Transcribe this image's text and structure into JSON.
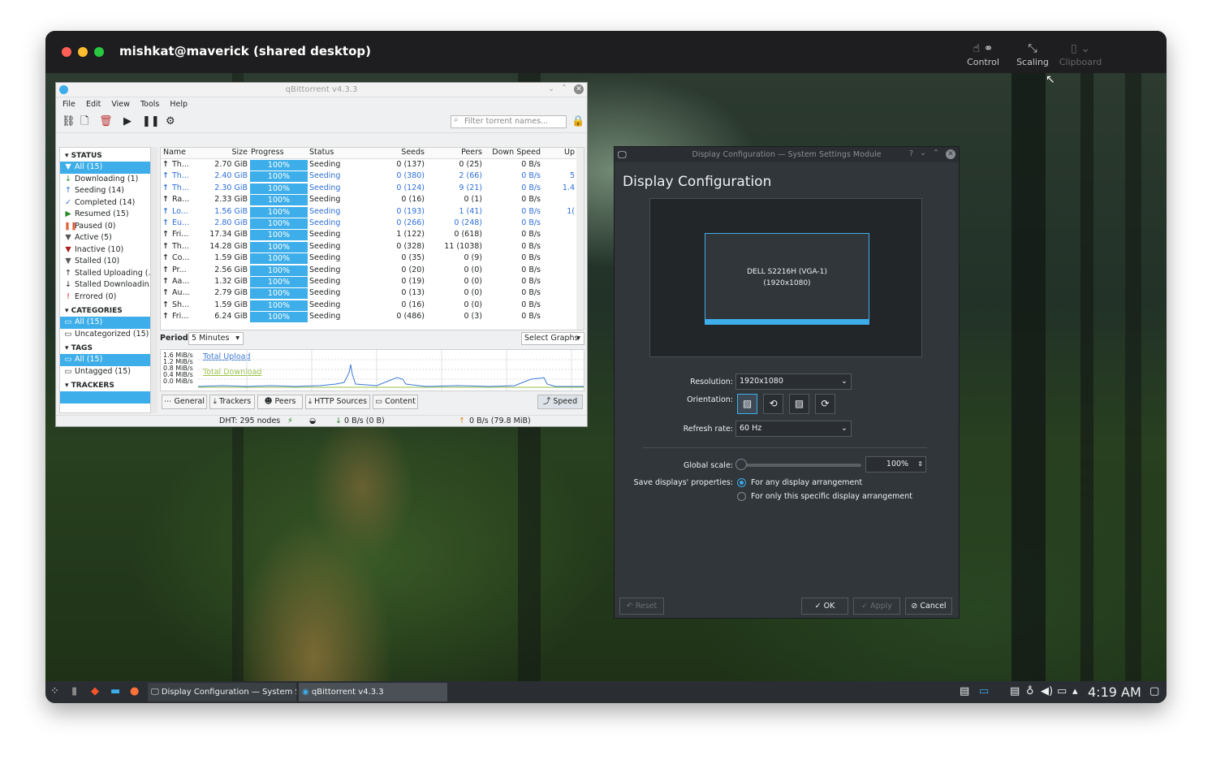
{
  "mac_window": {
    "title": "mishkat@maverick (shared desktop)",
    "controls": [
      {
        "label": "Control",
        "icon": "control-icon"
      },
      {
        "label": "Scaling",
        "icon": "scaling-icon"
      },
      {
        "label": "Clipboard",
        "icon": "clipboard-icon"
      }
    ]
  },
  "qbittorrent": {
    "title": "qBittorrent v4.3.3",
    "menu": [
      "File",
      "Edit",
      "View",
      "Tools",
      "Help"
    ],
    "filter_placeholder": "Filter torrent names...",
    "sidebar": {
      "status_header": "STATUS",
      "status": [
        "All (15)",
        "Downloading (1)",
        "Seeding (14)",
        "Completed (14)",
        "Resumed (15)",
        "Paused (0)",
        "Active (5)",
        "Inactive (10)",
        "Stalled (10)",
        "Stalled Uploading (...",
        "Stalled Downloadin...",
        "Errored (0)"
      ],
      "categories_header": "CATEGORIES",
      "categories": [
        "All (15)",
        "Uncategorized (15)"
      ],
      "tags_header": "TAGS",
      "tags": [
        "All (15)",
        "Untagged (15)"
      ],
      "trackers_header": "TRACKERS"
    },
    "columns": [
      "Name",
      "Size",
      "Progress",
      "Status",
      "Seeds",
      "Peers",
      "Down Speed",
      "Up"
    ],
    "rows": [
      {
        "name": "Th...",
        "size": "2.70 GiB",
        "progress": "100%",
        "status": "Seeding",
        "seeds": "0 (137)",
        "peers": "0 (25)",
        "down": "0 B/s",
        "up": "",
        "blue": false
      },
      {
        "name": "Th...",
        "size": "2.40 GiB",
        "progress": "100%",
        "status": "Seeding",
        "seeds": "0 (380)",
        "peers": "2 (66)",
        "down": "0 B/s",
        "up": "5",
        "blue": true
      },
      {
        "name": "Th...",
        "size": "2.30 GiB",
        "progress": "100%",
        "status": "Seeding",
        "seeds": "0 (124)",
        "peers": "9 (21)",
        "down": "0 B/s",
        "up": "1.4",
        "blue": true
      },
      {
        "name": "Ra...",
        "size": "2.33 GiB",
        "progress": "100%",
        "status": "Seeding",
        "seeds": "0 (16)",
        "peers": "0 (1)",
        "down": "0 B/s",
        "up": "",
        "blue": false
      },
      {
        "name": "Lo...",
        "size": "1.56 GiB",
        "progress": "100%",
        "status": "Seeding",
        "seeds": "0 (193)",
        "peers": "1 (41)",
        "down": "0 B/s",
        "up": "1(",
        "blue": true
      },
      {
        "name": "Eu...",
        "size": "2.80 GiB",
        "progress": "100%",
        "status": "Seeding",
        "seeds": "0 (266)",
        "peers": "0 (248)",
        "down": "0 B/s",
        "up": "",
        "blue": true
      },
      {
        "name": "Fri...",
        "size": "17.34 GiB",
        "progress": "100%",
        "status": "Seeding",
        "seeds": "1 (122)",
        "peers": "0 (618)",
        "down": "0 B/s",
        "up": "",
        "blue": false
      },
      {
        "name": "Th...",
        "size": "14.28 GiB",
        "progress": "100%",
        "status": "Seeding",
        "seeds": "0 (328)",
        "peers": "11 (1038)",
        "down": "0 B/s",
        "up": "",
        "blue": false
      },
      {
        "name": "Co...",
        "size": "1.59 GiB",
        "progress": "100%",
        "status": "Seeding",
        "seeds": "0 (35)",
        "peers": "0 (9)",
        "down": "0 B/s",
        "up": "",
        "blue": false
      },
      {
        "name": "Pr...",
        "size": "2.56 GiB",
        "progress": "100%",
        "status": "Seeding",
        "seeds": "0 (20)",
        "peers": "0 (0)",
        "down": "0 B/s",
        "up": "",
        "blue": false
      },
      {
        "name": "Aa...",
        "size": "1.32 GiB",
        "progress": "100%",
        "status": "Seeding",
        "seeds": "0 (19)",
        "peers": "0 (0)",
        "down": "0 B/s",
        "up": "",
        "blue": false
      },
      {
        "name": "Au...",
        "size": "2.79 GiB",
        "progress": "100%",
        "status": "Seeding",
        "seeds": "0 (13)",
        "peers": "0 (0)",
        "down": "0 B/s",
        "up": "",
        "blue": false
      },
      {
        "name": "Sh...",
        "size": "1.59 GiB",
        "progress": "100%",
        "status": "Seeding",
        "seeds": "0 (16)",
        "peers": "0 (0)",
        "down": "0 B/s",
        "up": "",
        "blue": false
      },
      {
        "name": "Fri...",
        "size": "6.24 GiB",
        "progress": "100%",
        "status": "Seeding",
        "seeds": "0 (486)",
        "peers": "0 (3)",
        "down": "0 B/s",
        "up": "",
        "blue": false
      }
    ],
    "period_label": "Period:",
    "period_value": "5 Minutes",
    "select_graphs": "Select Graphs",
    "graph_ticks": [
      "1.6 MiB/s",
      "1.2 MiB/s",
      "0.8 MiB/s",
      "0.4 MiB/s",
      "0.0 MiB/s"
    ],
    "graph_legend": {
      "upload": "Total Upload",
      "download": "Total Download"
    },
    "tabs": [
      "General",
      "Trackers",
      "Peers",
      "HTTP Sources",
      "Content",
      "Speed"
    ],
    "status_dht": "DHT: 295 nodes",
    "status_down": "0 B/s (0 B)",
    "status_up": "0 B/s (79.8 MiB)"
  },
  "display_config": {
    "window_title": "Display Configuration — System Settings Module",
    "heading": "Display Configuration",
    "monitor_name": "DELL S2216H (VGA-1)",
    "monitor_res": "(1920x1080)",
    "resolution_label": "Resolution:",
    "resolution_value": "1920x1080",
    "orientation_label": "Orientation:",
    "refresh_label": "Refresh rate:",
    "refresh_value": "60 Hz",
    "scale_label": "Global scale:",
    "scale_value": "100%",
    "save_label": "Save displays' properties:",
    "save_opt1": "For any display arrangement",
    "save_opt2": "For only this specific display arrangement",
    "btn_reset": "Reset",
    "btn_ok": "OK",
    "btn_apply": "Apply",
    "btn_cancel": "Cancel"
  },
  "taskbar": {
    "task1": "Display Configuration — System S...",
    "task2": "qBittorrent v4.3.3",
    "clock": "4:19 AM"
  }
}
